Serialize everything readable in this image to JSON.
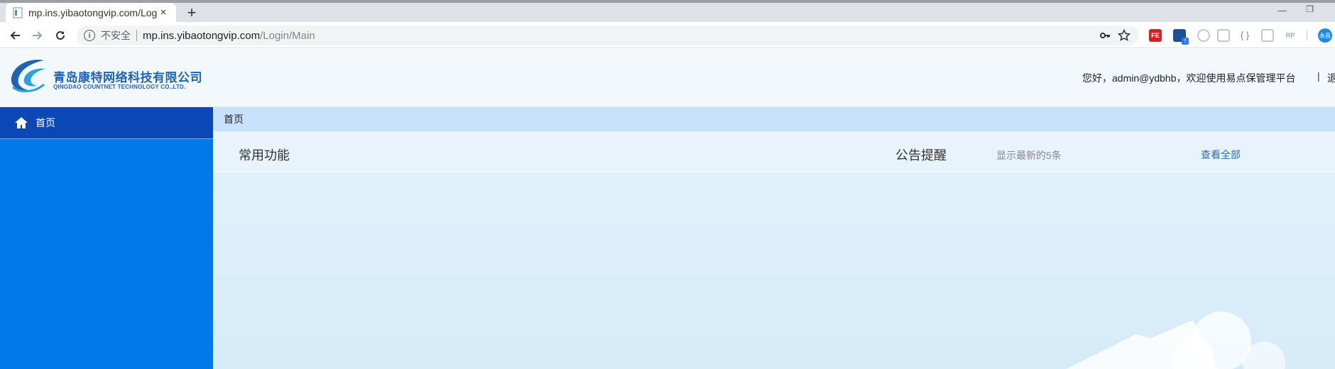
{
  "browser": {
    "tab_title": "mp.ins.yibaotongvip.com/Login",
    "new_tab_symbol": "+",
    "close_symbol": "×",
    "insecure_label": "不安全",
    "url_host": "mp.ins.yibaotongvip.com",
    "url_path": "/Login/Main",
    "extensions": {
      "fe": "FE",
      "braces": "{ }",
      "rp": "RP",
      "badge": "!",
      "avatar": "永昌"
    }
  },
  "header": {
    "company_cn": "青岛康特网络科技有限公司",
    "company_en": "QINGDAO COUNTNET TECHNOLOGY CO.,LTD.",
    "welcome": "您好，admin@ydbhb，欢迎使用易点保管理平台",
    "divider": "|",
    "logout": "退"
  },
  "sidebar": {
    "items": [
      {
        "label": "首页",
        "icon": "home-icon",
        "active": true
      }
    ]
  },
  "main": {
    "breadcrumb": "首页",
    "common_functions_title": "常用功能",
    "notice_title": "公告提醒",
    "notice_sub": "显示最新的5条",
    "view_all": "查看全部"
  },
  "colors": {
    "sidebar_bg": "#0079ea",
    "sidebar_active": "#0a48b8",
    "crumb_bar": "#c9e2fb",
    "brand": "#1d64b7",
    "link": "#2b6cb8"
  }
}
